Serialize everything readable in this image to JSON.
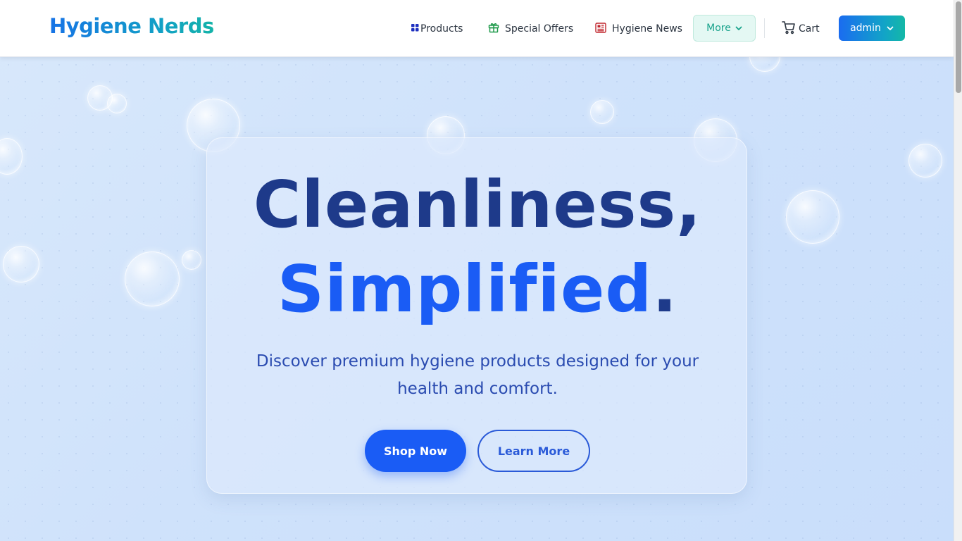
{
  "brand": {
    "name": "Hygiene Nerds"
  },
  "nav": {
    "products": "Products",
    "special_offers": "Special Offers",
    "hygiene_news": "Hygiene News",
    "more": "More",
    "cart": "Cart",
    "user": "admin"
  },
  "hero": {
    "title_line1": "Cleanliness,",
    "title_line2": "Simplified",
    "title_dot": ".",
    "subtitle": "Discover premium hygiene products designed for your health and comfort.",
    "primary_cta": "Shop Now",
    "secondary_cta": "Learn More"
  },
  "icons": {
    "products": "grid-icon",
    "special_offers": "gift-icon",
    "hygiene_news": "newspaper-icon",
    "more": "chevron-down-icon",
    "cart": "cart-icon",
    "user": "chevron-down-icon"
  },
  "colors": {
    "accent_blue": "#1a5cf5",
    "heading_navy": "#1e3a8a",
    "teal": "#14b8a6",
    "background": "#cfe2fb"
  }
}
